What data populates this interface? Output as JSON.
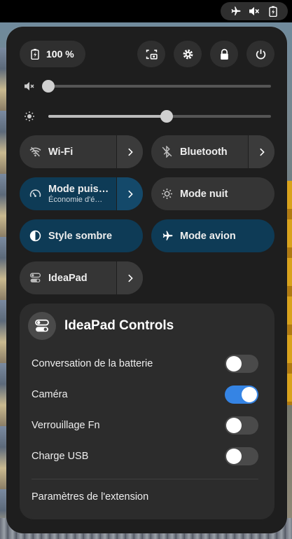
{
  "status_area": {
    "icons": [
      "airplane-icon",
      "speaker-muted-icon",
      "battery-charging-icon"
    ]
  },
  "quick_settings": {
    "battery": {
      "label": "100 %"
    },
    "buttons": [
      "screenshot-icon",
      "settings-icon",
      "lock-icon",
      "power-icon"
    ],
    "volume": {
      "muted": true,
      "level": 0.0
    },
    "brightness": {
      "level": 0.53
    },
    "toggles": {
      "wifi": {
        "label": "Wi-Fi",
        "active": false
      },
      "bluetooth": {
        "label": "Bluetooth",
        "active": false
      },
      "power_mode": {
        "label": "Mode puis…",
        "sublabel": "Économie d'é…",
        "active": true
      },
      "night_mode": {
        "label": "Mode nuit",
        "active": false
      },
      "dark_style": {
        "label": "Style sombre",
        "active": true
      },
      "airplane": {
        "label": "Mode avion",
        "active": true
      },
      "ideapad": {
        "label": "IdeaPad",
        "active": false
      }
    }
  },
  "ideapad_controls": {
    "title": "IdeaPad Controls",
    "rows": [
      {
        "label": "Conversation de la batterie",
        "on": false
      },
      {
        "label": "Caméra",
        "on": true
      },
      {
        "label": "Verrouillage Fn",
        "on": false
      },
      {
        "label": "Charge USB",
        "on": false
      }
    ],
    "settings_label": "Paramètres de l'extension"
  },
  "colors": {
    "accent": "#3584e4",
    "active_toggle": "#0e3b56",
    "panel": "#1e1e1e"
  }
}
